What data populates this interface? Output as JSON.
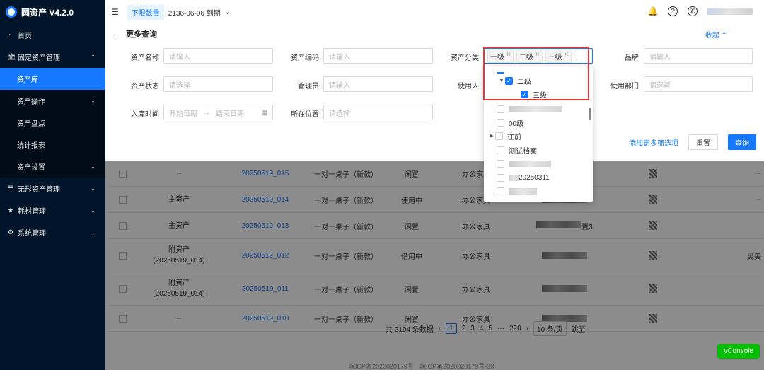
{
  "app": {
    "title": "圆资产 V4.2.0"
  },
  "sidebar": {
    "items": [
      {
        "label": "首页",
        "icon": "home-icon"
      },
      {
        "label": "固定资产管理",
        "icon": "bank-icon"
      },
      {
        "label": "资产库"
      },
      {
        "label": "资产操作"
      },
      {
        "label": "资产盘点"
      },
      {
        "label": "统计报表"
      },
      {
        "label": "资产设置"
      },
      {
        "label": "无形资产管理",
        "icon": "list-icon"
      },
      {
        "label": "耗材管理",
        "icon": "star-icon"
      },
      {
        "label": "系统管理",
        "icon": "gear-icon"
      }
    ]
  },
  "topbar": {
    "quota_tag": "不限数量",
    "expiry": "2136-06-06 到期"
  },
  "search_panel": {
    "title": "更多查询",
    "collapse": "收起",
    "fields": {
      "asset_name": {
        "label": "资产名称",
        "placeholder": "请输入"
      },
      "asset_code": {
        "label": "资产编码",
        "placeholder": "请输入"
      },
      "asset_category": {
        "label": "资产分类"
      },
      "brand": {
        "label": "品牌",
        "placeholder": "请输入"
      },
      "asset_status": {
        "label": "资产状态",
        "placeholder": "请选择"
      },
      "manager": {
        "label": "管理员",
        "placeholder": "请输入"
      },
      "user": {
        "label": "使用人"
      },
      "department": {
        "label": "使用部门",
        "placeholder": "请选择"
      },
      "inbound_time": {
        "label": "入库时间",
        "start": "开始日期",
        "end": "结束日期"
      },
      "location": {
        "label": "所在位置",
        "placeholder": "请选择"
      }
    },
    "selected_tags": [
      "一级",
      "二级",
      "三级"
    ],
    "add_filters": "添加更多筛选项",
    "reset": "重置",
    "query": "查询"
  },
  "category_tree": {
    "level2": "二级",
    "level3": "三级",
    "items": [
      "00级",
      "往前",
      "测试档案",
      "20250311"
    ]
  },
  "table": {
    "rows": [
      {
        "type": "--",
        "code": "20250519_015",
        "name": "一对一桌子（新款）",
        "status": "闲置",
        "category": "办公家具"
      },
      {
        "type": "主资产",
        "code": "20250519_014",
        "name": "一对一桌子（新款）",
        "status": "使用中",
        "category": "办公家具"
      },
      {
        "type": "主资产",
        "code": "20250519_013",
        "name": "一对一桌子（新款）",
        "status": "闲置",
        "category": "办公家具",
        "location_suffix": "置3"
      },
      {
        "type": "附资产",
        "type_sub": "(20250519_014)",
        "code": "20250519_012",
        "name": "一对一桌子（新款）",
        "status": "借用中",
        "category": "办公家具",
        "end": "吴美"
      },
      {
        "type": "附资产",
        "type_sub": "(20250519_014)",
        "code": "20250519_011",
        "name": "一对一桌子（新款）",
        "status": "闲置",
        "category": "办公家具"
      },
      {
        "type": "--",
        "code": "20250519_010",
        "name": "一对一桌子（新款）",
        "status": "闲置",
        "category": "办公家具"
      }
    ]
  },
  "pagination": {
    "total": "共 2194 条数据",
    "pages": [
      "1",
      "2",
      "3",
      "4",
      "5",
      "···",
      "220"
    ],
    "page_size": "10 条/页",
    "goto": "跳至"
  },
  "vconsole": "vConsole",
  "footer": {
    "icp1": "皖ICP备2020020179号",
    "icp2": "皖ICP备2020020179号-3X"
  }
}
